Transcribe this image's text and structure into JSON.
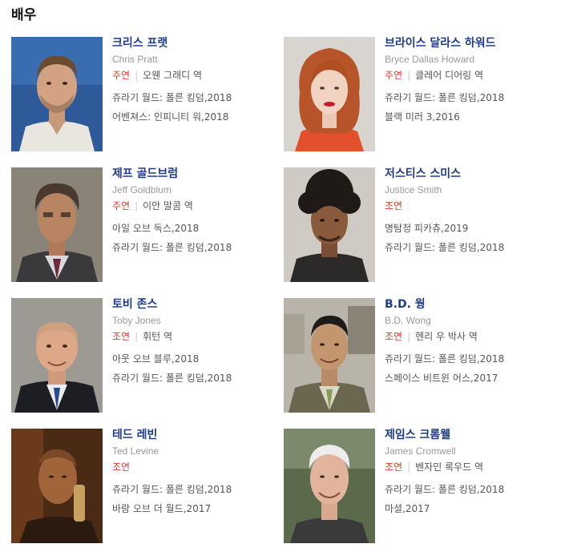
{
  "section": {
    "title": "배우"
  },
  "actors": [
    {
      "name": "크리스 프랫",
      "eng": "Chris Pratt",
      "role": "주연",
      "character": "오웬 그래디 역",
      "works": [
        "쥬라기 월드: 폴른 킹덤,2018",
        "어벤져스: 인피니티 워,2018"
      ]
    },
    {
      "name": "브라이스 달라스 하워드",
      "eng": "Bryce Dallas Howard",
      "role": "주연",
      "character": "클레어 디어링 역",
      "works": [
        "쥬라기 월드: 폴른 킹덤,2018",
        "블랙 미러 3,2016"
      ]
    },
    {
      "name": "제프 골드브럼",
      "eng": "Jeff Goldblum",
      "role": "주연",
      "character": "이안 말콤 역",
      "works": [
        "아일 오브 독스,2018",
        "쥬라기 월드: 폴른 킹덤,2018"
      ]
    },
    {
      "name": "저스티스 스미스",
      "eng": "Justice Smith",
      "role": "조연",
      "character": "",
      "works": [
        "명탐정 피카츄,2019",
        "쥬라기 월드: 폴른 킹덤,2018"
      ]
    },
    {
      "name": "토비 존스",
      "eng": "Toby Jones",
      "role": "조연",
      "character": "휘턴 역",
      "works": [
        "아웃 오브 블루,2018",
        "쥬라기 월드: 폴른 킹덤,2018"
      ]
    },
    {
      "name": "B.D. 웡",
      "eng": "B.D. Wong",
      "role": "조연",
      "character": "헨리 우 박사 역",
      "works": [
        "쥬라기 월드: 폴른 킹덤,2018",
        "스페이스 비트윈 어스,2017"
      ]
    },
    {
      "name": "테드 레빈",
      "eng": "Ted Levine",
      "role": "조연",
      "character": "",
      "works": [
        "쥬라기 월드: 폴른 킹덤,2018",
        "바람 오브 더 월드,2017"
      ]
    },
    {
      "name": "제임스 크롬웰",
      "eng": "James Cromwell",
      "role": "조연",
      "character": "벤자민 록우드 역",
      "works": [
        "쥬라기 월드: 폴른 킹덤,2018",
        "마셜,2017"
      ]
    }
  ]
}
